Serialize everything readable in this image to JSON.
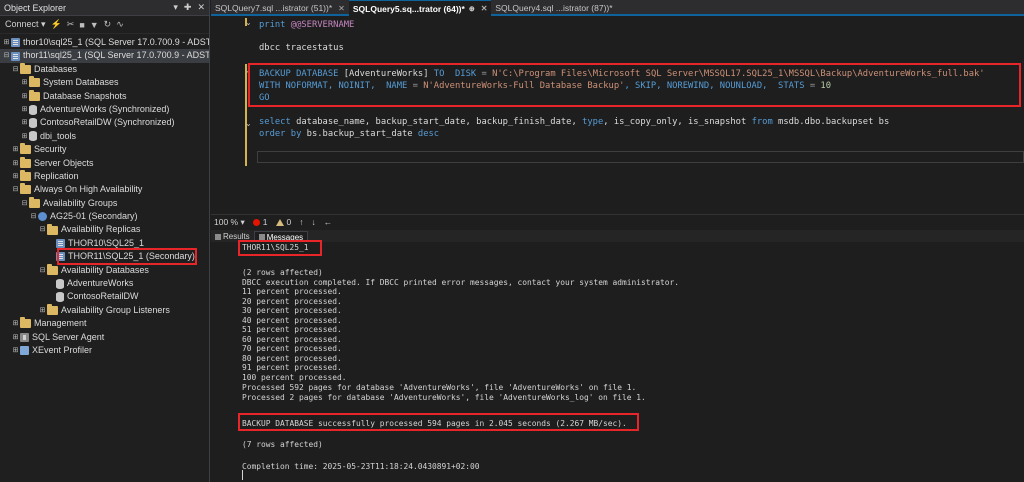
{
  "object_explorer": {
    "title": "Object Explorer",
    "pin_glyph": "▾",
    "pin2_glyph": "✚",
    "close_glyph": "✕",
    "connect_label": "Connect ▾",
    "toolbar_icons": [
      "plug-icon",
      "disconnect-icon",
      "stop-icon",
      "filter-icon",
      "refresh-icon",
      "activity-icon"
    ],
    "nodes": [
      {
        "label": "thor10\\sql25_1 (SQL Server 17.0.700.9 - ADSTS",
        "exp": "⊞",
        "icon": "server"
      },
      {
        "label": "thor11\\sql25_1 (SQL Server 17.0.700.9 - ADSTS",
        "exp": "⊟",
        "icon": "server"
      },
      {
        "label": "Databases",
        "exp": "⊟",
        "icon": "folder"
      },
      {
        "label": "System Databases",
        "exp": "⊞",
        "icon": "folder"
      },
      {
        "label": "Database Snapshots",
        "exp": "⊞",
        "icon": "folder"
      },
      {
        "label": "AdventureWorks (Synchronized)",
        "exp": "⊞",
        "icon": "db"
      },
      {
        "label": "ContosoRetailDW (Synchronized)",
        "exp": "⊞",
        "icon": "db"
      },
      {
        "label": "dbi_tools",
        "exp": "⊞",
        "icon": "db"
      },
      {
        "label": "Security",
        "exp": "⊞",
        "icon": "folder"
      },
      {
        "label": "Server Objects",
        "exp": "⊞",
        "icon": "folder"
      },
      {
        "label": "Replication",
        "exp": "⊞",
        "icon": "folder"
      },
      {
        "label": "Always On High Availability",
        "exp": "⊟",
        "icon": "folder"
      },
      {
        "label": "Availability Groups",
        "exp": "⊟",
        "icon": "folder"
      },
      {
        "label": "AG25-01 (Secondary)",
        "exp": "⊟",
        "icon": "ag"
      },
      {
        "label": "Availability Replicas",
        "exp": "⊟",
        "icon": "folder"
      },
      {
        "label": "THOR10\\SQL25_1",
        "exp": "",
        "icon": "server"
      },
      {
        "label": "THOR11\\SQL25_1 (Secondary)",
        "exp": "",
        "icon": "server"
      },
      {
        "label": "Availability Databases",
        "exp": "⊟",
        "icon": "folder"
      },
      {
        "label": "AdventureWorks",
        "exp": "",
        "icon": "db"
      },
      {
        "label": "ContosoRetailDW",
        "exp": "",
        "icon": "db"
      },
      {
        "label": "Availability Group Listeners",
        "exp": "⊞",
        "icon": "folder"
      },
      {
        "label": "Management",
        "exp": "⊞",
        "icon": "folder"
      },
      {
        "label": "SQL Server Agent",
        "exp": "⊞",
        "icon": "agent"
      },
      {
        "label": "XEvent Profiler",
        "exp": "⊞",
        "icon": "xevent"
      }
    ]
  },
  "tabs": [
    {
      "label": "SQLQuery7.sql ...istrator (51))*",
      "close": "✕",
      "active": false
    },
    {
      "label": "SQLQuery5.sq...trator (64))*",
      "close": "✕",
      "active": true,
      "pin": "⊕"
    },
    {
      "label": "SQLQuery4.sql ...istrator (87))*",
      "close": "",
      "active": false
    }
  ],
  "editor": {
    "lines": {
      "l1_kw": "print",
      "l1_sys": " @@SERVERNAME",
      "l2": "dbcc tracestatus",
      "l3_kw": "BACKUP DATABASE",
      "l3_a": " [AdventureWorks] ",
      "l3_kw2": "TO  DISK",
      "l3_b": " = ",
      "l3_str": "N'C:\\Program Files\\Microsoft SQL Server\\MSSQL17.SQL25_1\\MSSQL\\Backup\\AdventureWorks_full.bak'",
      "l4_kw": "WITH NOFORMAT, NOINIT,  NAME",
      "l4_b": " = ",
      "l4_str": "N'AdventureWorks-Full Database Backup'",
      "l4_kw2": ", SKIP, NOREWIND, NOUNLOAD,  STATS",
      "l4_c": " = ",
      "l4_num": "10",
      "l5": "GO",
      "l6_kw": "select",
      "l6_a": " database_name, backup_start_date, backup_finish_date, ",
      "l6_kw2": "type",
      "l6_b": ", is_copy_only, is_snapshot ",
      "l6_kw3": "from",
      "l6_c": " msdb.dbo.backupset bs",
      "l7_kw": "order by",
      "l7_a": " bs.backup_start_date ",
      "l7_kw2": "desc"
    },
    "fold_glyph": "⌄"
  },
  "status": {
    "zoom": "100 %",
    "zoom_arrow": "▾",
    "errors": "1",
    "warnings": "0",
    "nav_up": "↑",
    "nav_down": "↓",
    "nav_back": "←"
  },
  "result_tabs": [
    "Results",
    "Messages"
  ],
  "messages": [
    "THOR11\\SQL25_1",
    "",
    "(2 rows affected)",
    "DBCC execution completed. If DBCC printed error messages, contact your system administrator.",
    "11 percent processed.",
    "20 percent processed.",
    "30 percent processed.",
    "40 percent processed.",
    "51 percent processed.",
    "60 percent processed.",
    "70 percent processed.",
    "80 percent processed.",
    "91 percent processed.",
    "100 percent processed.",
    "Processed 592 pages for database 'AdventureWorks', file 'AdventureWorks' on file 1.",
    "Processed 2 pages for database 'AdventureWorks', file 'AdventureWorks_log' on file 1.",
    "BACKUP DATABASE successfully processed 594 pages in 2.045 seconds (2.267 MB/sec).",
    "",
    "(7 rows affected)",
    "",
    "Completion time: 2025-05-23T11:18:24.0430891+02:00"
  ],
  "colors": {
    "highlight_box": "#e8262a",
    "keyword": "#569cd6",
    "string": "#ce9178",
    "system_var": "#c586c0",
    "tab_accent": "#0e639c"
  }
}
